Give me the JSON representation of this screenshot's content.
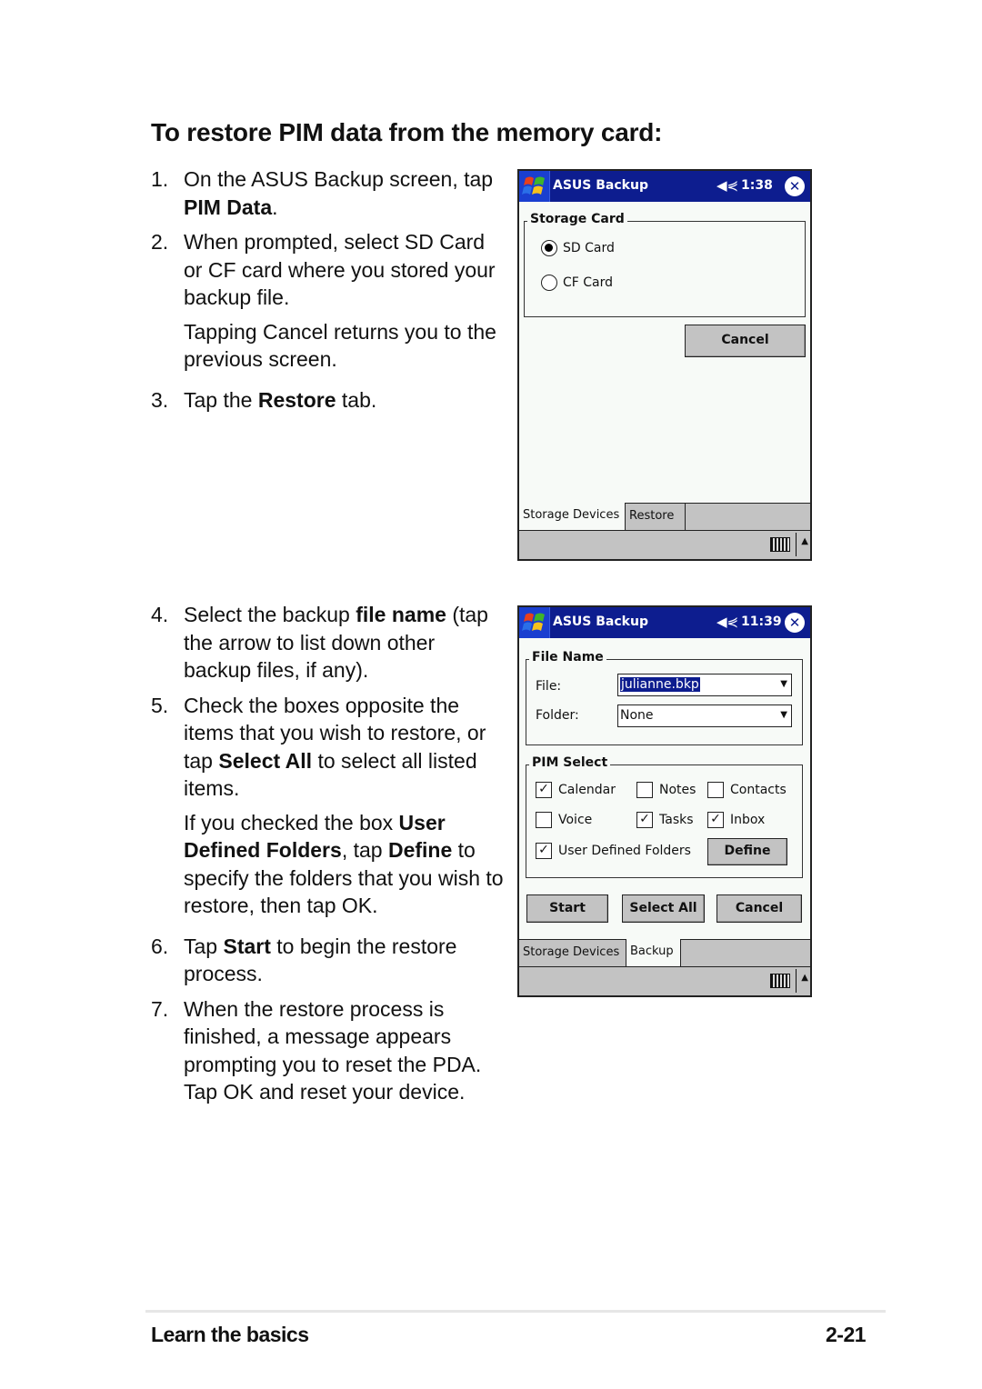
{
  "heading": "To restore PIM data from the memory card:",
  "steps": {
    "s1": {
      "num": "1.",
      "a": "On the ASUS Backup screen, tap ",
      "b": "PIM Data",
      "c": "."
    },
    "s2": {
      "num": "2.",
      "text": "When prompted, select SD Card or CF card where you stored your backup file."
    },
    "s2_note": "Tapping Cancel returns you to the previous screen.",
    "s3": {
      "num": "3.",
      "a": "Tap the ",
      "b": "Restore",
      "c": " tab."
    },
    "s4": {
      "num": "4.",
      "a": "Select the backup ",
      "b": "file name",
      "c": "  (tap the arrow to list down other backup files, if any)."
    },
    "s5": {
      "num": "5.",
      "a": "Check the boxes opposite the items that you wish to restore, or tap ",
      "b": "Select All",
      "c": " to select all listed items."
    },
    "s5_note": {
      "a": "If you checked the box ",
      "b": "User Defined Folders",
      "c": ", tap ",
      "d": "Define",
      "e": " to specify the folders that you wish to restore, then tap OK."
    },
    "s6": {
      "num": "6.",
      "a": "Tap ",
      "b": "Start",
      "c": " to begin the restore process."
    },
    "s7": {
      "num": "7.",
      "text": "When the restore process is finished, a message appears prompting you to reset the PDA. Tap OK and reset your device."
    }
  },
  "screen1": {
    "title": "ASUS Backup",
    "speaker_icon": "speaker-icon",
    "time": "1:38",
    "close_icon": "close-icon",
    "group_label": "Storage Card",
    "options": [
      {
        "label": "SD Card",
        "selected": true
      },
      {
        "label": "CF Card",
        "selected": false
      }
    ],
    "cancel": "Cancel",
    "tabs": [
      "Storage Devices",
      "Restore"
    ],
    "active_tab": "Storage Devices"
  },
  "screen2": {
    "title": "ASUS Backup",
    "time": "11:39",
    "file_group": "File Name",
    "file_label": "File:",
    "file_value": "julianne.bkp",
    "folder_label": "Folder:",
    "folder_value": "None",
    "pim_group": "PIM Select",
    "checkboxes": [
      {
        "label": "Calendar",
        "checked": true
      },
      {
        "label": "Notes",
        "checked": false
      },
      {
        "label": "Contacts",
        "checked": false
      },
      {
        "label": "Voice",
        "checked": false
      },
      {
        "label": "Tasks",
        "checked": true
      },
      {
        "label": "Inbox",
        "checked": true
      },
      {
        "label": "User Defined Folders",
        "checked": true
      }
    ],
    "define": "Define",
    "start": "Start",
    "select_all": "Select All",
    "cancel": "Cancel",
    "tabs": [
      "Storage Devices",
      "Backup"
    ],
    "active_tab": "Backup"
  },
  "footer": {
    "section": "Learn the basics",
    "page": "2-21"
  },
  "colors": {
    "titlebar": "#0d1d8f",
    "button_gray": "#c3c3c3",
    "screen_bg": "#f7faf7"
  }
}
